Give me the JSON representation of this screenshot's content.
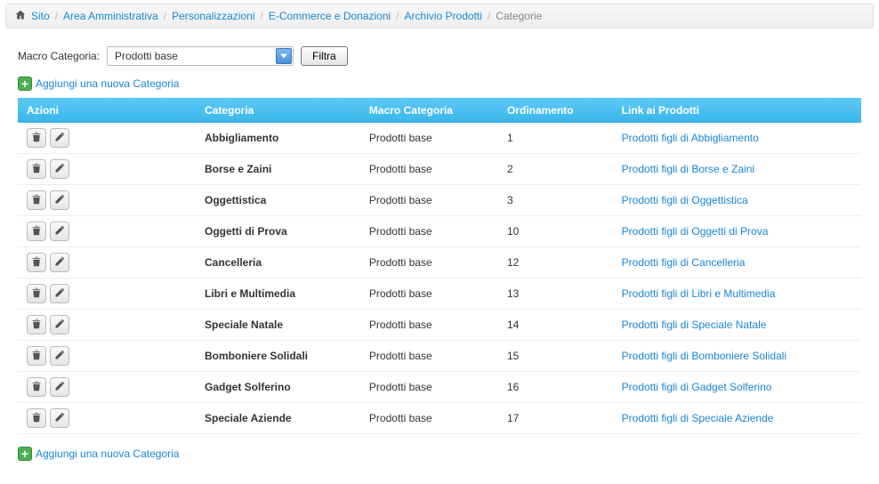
{
  "breadcrumb": {
    "sito": "Sito",
    "area": "Area Amministrativa",
    "personalizzazioni": "Personalizzazioni",
    "ecommerce": "E-Commerce e Donazioni",
    "archivio": "Archivio Prodotti",
    "current": "Categorie"
  },
  "filter": {
    "label": "Macro Categoria:",
    "selected": "Prodotti base",
    "button": "Filtra"
  },
  "addCategory": "Aggiungi una nuova Categoria",
  "headers": {
    "azioni": "Azioni",
    "categoria": "Categoria",
    "macro": "Macro Categoria",
    "ordinamento": "Ordinamento",
    "link": "Link ai Prodotti"
  },
  "rows": [
    {
      "cat": "Abbigliamento",
      "macro": "Prodotti base",
      "ord": "1",
      "link": "Prodotti figli di Abbigliamento"
    },
    {
      "cat": "Borse e Zaini",
      "macro": "Prodotti base",
      "ord": "2",
      "link": "Prodotti figli di Borse e Zaini"
    },
    {
      "cat": "Oggettistica",
      "macro": "Prodotti base",
      "ord": "3",
      "link": "Prodotti figli di Oggettistica"
    },
    {
      "cat": "Oggetti di Prova",
      "macro": "Prodotti base",
      "ord": "10",
      "link": "Prodotti figli di Oggetti di Prova"
    },
    {
      "cat": "Cancelleria",
      "macro": "Prodotti base",
      "ord": "12",
      "link": "Prodotti figli di Cancelleria"
    },
    {
      "cat": "Libri e Multimedia",
      "macro": "Prodotti base",
      "ord": "13",
      "link": "Prodotti figli di Libri e Multimedia"
    },
    {
      "cat": "Speciale Natale",
      "macro": "Prodotti base",
      "ord": "14",
      "link": "Prodotti figli di Speciale Natale"
    },
    {
      "cat": "Bomboniere Solidali",
      "macro": "Prodotti base",
      "ord": "15",
      "link": "Prodotti figli di Bomboniere Solidali"
    },
    {
      "cat": "Gadget Solferino",
      "macro": "Prodotti base",
      "ord": "16",
      "link": "Prodotti figli di Gadget Solferino"
    },
    {
      "cat": "Speciale Aziende",
      "macro": "Prodotti base",
      "ord": "17",
      "link": "Prodotti figli di Speciale Aziende"
    }
  ]
}
